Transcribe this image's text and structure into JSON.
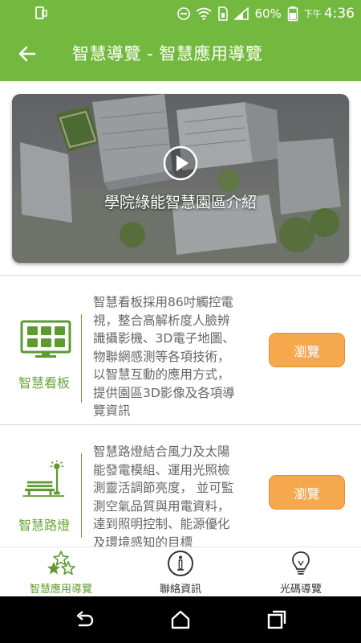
{
  "status_bar": {
    "battery_percent": "60%",
    "ampm": "下午",
    "time": "4:36",
    "icons": [
      "tablet-icon",
      "dnd-icon",
      "wifi-icon",
      "sim-icon",
      "signal-icon",
      "battery-icon"
    ]
  },
  "app_bar": {
    "title": "智慧導覽 - 智慧應用導覽",
    "back_icon": "arrow-left-icon"
  },
  "video": {
    "caption": "學院綠能智慧園區介紹",
    "play_icon": "play-circle-icon"
  },
  "features": [
    {
      "label": "智慧看板",
      "icon": "smart-board-icon",
      "description": "智慧看板採用86吋觸控電視，整合高解析度人臉辨識攝影機、3D電子地圖、物聯網感測等各項技術，以智慧互動的應用方式，提供園區3D影像及各項導覽資訊",
      "lines": [
        "智慧看板採用86吋觸控電",
        "視，整合高解析度人臉辨",
        "識攝影機、3D電子地圖、",
        "物聯網感測等各項技術，",
        "以智慧互動的應用方式，",
        "提供園區3D影像及各項導",
        "覽資訊"
      ],
      "button": "瀏覽"
    },
    {
      "label": "智慧路燈",
      "icon": "street-lamp-bench-icon",
      "lines": [
        "智慧路燈結合風力及太陽",
        "能發電模組、運用光照檢",
        "測靈活調節亮度， 並可監",
        "測空氣品質與用電資料，",
        "達到照明控制、能源優化",
        "及環境感知的目標"
      ],
      "button": "瀏覽"
    }
  ],
  "bottom_nav": [
    {
      "label": "智慧應用導覽",
      "icon": "stars-icon",
      "active": true
    },
    {
      "label": "聯絡資訊",
      "icon": "info-circle-icon",
      "active": false
    },
    {
      "label": "光碼導覽",
      "icon": "lightbulb-icon",
      "active": false
    }
  ],
  "system_nav": [
    "back-icon",
    "home-icon",
    "recents-icon"
  ],
  "colors": {
    "primary_green": "#73b83f",
    "label_green": "#6aa43a",
    "button_orange": "#f6a84d"
  }
}
